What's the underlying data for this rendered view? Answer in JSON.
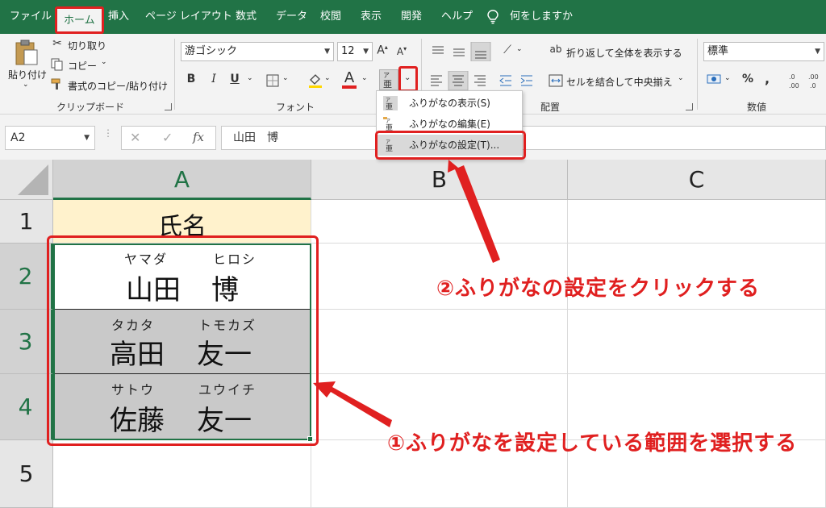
{
  "ribbon_tabs": [
    {
      "label": "ファイル",
      "active": false
    },
    {
      "label": "ホーム",
      "active": true
    },
    {
      "label": "挿入",
      "active": false
    },
    {
      "label": "ページ レイアウト",
      "active": false
    },
    {
      "label": "数式",
      "active": false
    },
    {
      "label": "データ",
      "active": false
    },
    {
      "label": "校閲",
      "active": false
    },
    {
      "label": "表示",
      "active": false
    },
    {
      "label": "開発",
      "active": false
    },
    {
      "label": "ヘルプ",
      "active": false
    }
  ],
  "tell_me": "何をしますか",
  "clipboard": {
    "paste": "貼り付け",
    "cut": "切り取り",
    "copy": "コピー",
    "format_painter": "書式のコピー/貼り付け",
    "group_label": "クリップボード"
  },
  "font": {
    "font_name": "游ゴシック",
    "font_size": "12",
    "bold": "B",
    "italic": "I",
    "underline": "U",
    "font_color_glyph": "A",
    "grow": "A",
    "shrink": "A",
    "group_label": "フォント"
  },
  "alignment": {
    "wrap_text": "折り返して全体を表示する",
    "merge_center": "セルを結合して中央揃え",
    "group_label": "配置"
  },
  "number": {
    "format": "標準",
    "percent": "%",
    "comma": ",",
    "group_label": "数値"
  },
  "furigana_menu": [
    {
      "label": "ふりがなの表示(S)",
      "selected": false
    },
    {
      "label": "ふりがなの編集(E)",
      "selected": false
    },
    {
      "label": "ふりがなの設定(T)...",
      "selected": true
    }
  ],
  "formula_bar": {
    "name_box": "A2",
    "fx": "fx",
    "content": "山田　博"
  },
  "columns": [
    "A",
    "B",
    "C"
  ],
  "rows": [
    "1",
    "2",
    "3",
    "4",
    "5"
  ],
  "cells": {
    "header": "氏名",
    "names": [
      {
        "family_kana": "ヤマダ",
        "given_kana": "ヒロシ",
        "family": "山田",
        "given": "博"
      },
      {
        "family_kana": "タカタ",
        "given_kana": "トモカズ",
        "family": "高田",
        "given": "友一"
      },
      {
        "family_kana": "サトウ",
        "given_kana": "ユウイチ",
        "family": "佐藤",
        "given": "友一"
      }
    ]
  },
  "annotations": {
    "step1": "①ふりがなを設定している範囲を選択する",
    "step2": "②ふりがなの設定をクリックする"
  },
  "colors": {
    "excel_green": "#217346",
    "highlight_red": "#e02020",
    "header_fill": "#fff2cc",
    "selection_fill": "#c9c9c9"
  }
}
